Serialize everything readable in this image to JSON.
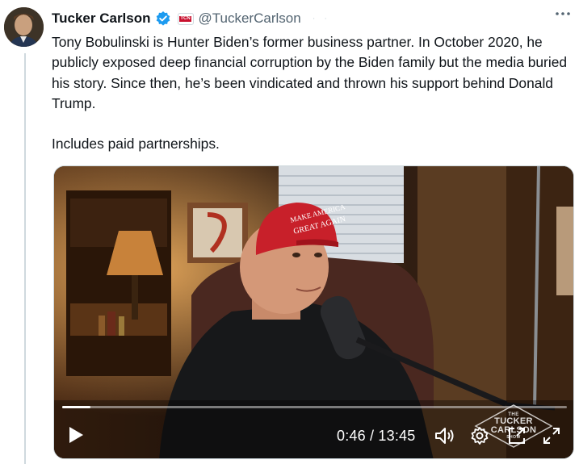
{
  "tweet": {
    "author": {
      "display_name": "Tucker Carlson",
      "handle": "@TuckerCarlson",
      "verified": true,
      "affiliate_badge_text": "TCN"
    },
    "more_icon": "more-horizontal-icon",
    "text": "Tony Bobulinski is Hunter Biden’s former business partner. In October 2020, he publicly exposed deep financial corruption by the Biden family but the media buried his story. Since then, he’s been vindicated and thrown his support behind Donald Trump.\n\nIncludes paid partnerships.",
    "media": {
      "hat_text_line1": "MAKE AMERICA",
      "hat_text_line2": "GREAT AGAIN",
      "player": {
        "time_display": "0:46 / 13:45",
        "progress": 0.056,
        "controls": [
          "play-icon",
          "volume-icon",
          "settings-icon",
          "pip-icon",
          "fullscreen-icon"
        ]
      },
      "watermark": {
        "line1": "THE",
        "line2": "TUCKER",
        "line3": "CARLSON",
        "line4": "SHOW"
      }
    }
  },
  "colors": {
    "verified": "#1d9bf0",
    "handle": "#536471",
    "text": "#0f1419",
    "thread_line": "#cfd9de"
  }
}
